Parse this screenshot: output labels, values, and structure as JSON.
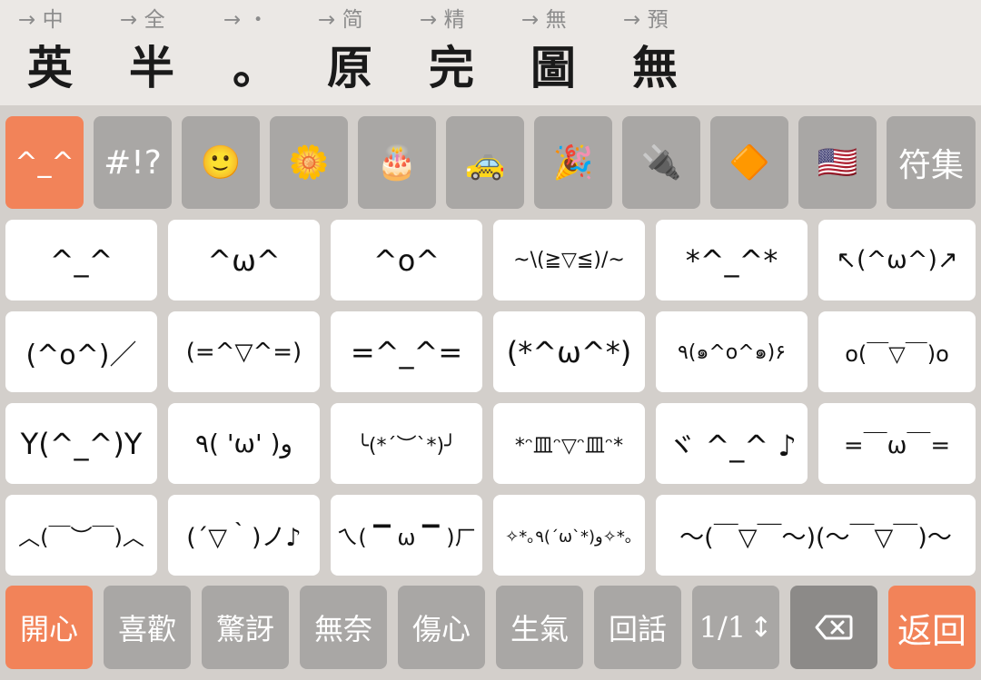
{
  "candidates": [
    {
      "hint": "→ 中",
      "label": "英"
    },
    {
      "hint": "→ 全",
      "label": "半"
    },
    {
      "hint": "→ ・",
      "label": "。"
    },
    {
      "hint": "→ 简",
      "label": "原"
    },
    {
      "hint": "→ 精",
      "label": "完"
    },
    {
      "hint": "→ 無",
      "label": "圖"
    },
    {
      "hint": "→ 預",
      "label": "無"
    }
  ],
  "categories": [
    {
      "label": "^_^",
      "icon": "kaomoji",
      "active": true
    },
    {
      "label": "#!?",
      "icon": "symbols"
    },
    {
      "label": "🙂",
      "icon": "smiley-icon"
    },
    {
      "label": "🌼",
      "icon": "flower-icon"
    },
    {
      "label": "🎂",
      "icon": "cake-icon"
    },
    {
      "label": "🚕",
      "icon": "taxi-icon"
    },
    {
      "label": "🎉",
      "icon": "party-popper-icon"
    },
    {
      "label": "🔌",
      "icon": "plug-icon"
    },
    {
      "label": "🔶",
      "icon": "orange-diamond-icon"
    },
    {
      "label": "🇺🇸",
      "icon": "us-flag-icon"
    },
    {
      "label": "符集",
      "icon": "symbol-set"
    }
  ],
  "grid": [
    [
      "^_^",
      "^ω^",
      "^o^",
      "~\\(≧▽≦)/~",
      "*^_^*",
      "↖(^ω^)↗"
    ],
    [
      "(^o^)／",
      "(=^▽^=)",
      "=^_^=",
      "(*^ω^*)",
      "٩(๑^o^๑)۶",
      "o(￣▽￣)o"
    ],
    [
      "Y(^_^)Y",
      "٩( 'ω' )و",
      "╰(*´︶`*)╯",
      "*ᵔ皿ᵔ▽ᵔ皿ᵔ*",
      "ヾ ^_^ ♪",
      "=￣ω￣="
    ],
    [
      "︿(￣︶￣)︿",
      "(´▽｀)ノ♪",
      "ㄟ( ▔ ω ▔ )ㄏ",
      "✧*｡٩(ˊωˋ*)و✧*｡",
      "～(￣▽￣～)(～￣▽￣)～"
    ]
  ],
  "bottom": {
    "tabs": [
      "開心",
      "喜歡",
      "驚訝",
      "無奈",
      "傷心",
      "生氣",
      "回話"
    ],
    "page": "1/1",
    "page_icon": "up-down-arrow-icon",
    "delete_icon": "backspace-icon",
    "back": "返回"
  },
  "colors": {
    "accent": "#f28359",
    "key_gray": "#a9a7a5",
    "key_white": "#ffffff",
    "background": "#d3cfcb",
    "topbar": "#ebe8e5"
  }
}
